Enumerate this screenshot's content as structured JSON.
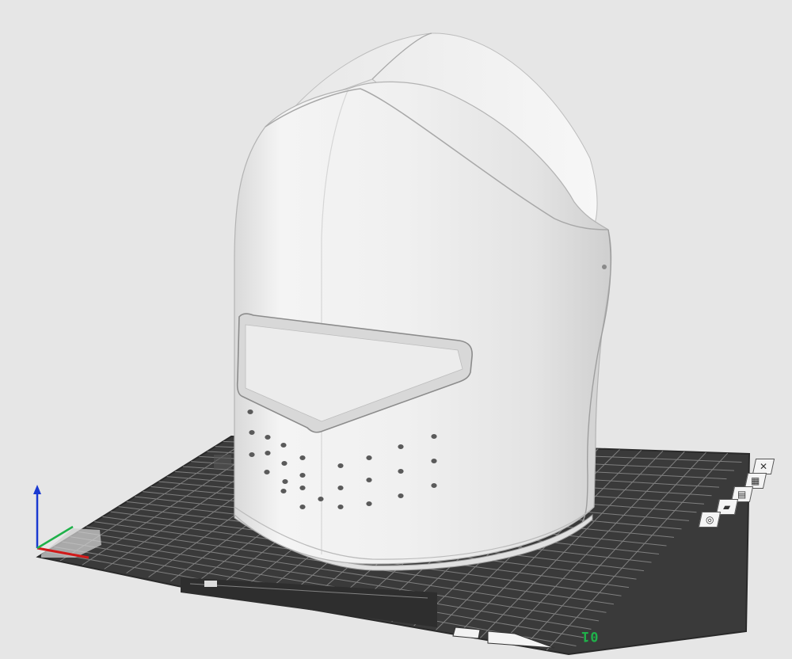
{
  "plate": {
    "id_label": "01"
  },
  "plate_tools": [
    {
      "name": "close-icon",
      "glyph": "✕"
    },
    {
      "name": "arrange-icon",
      "glyph": "▦"
    },
    {
      "name": "orient-icon",
      "glyph": "▤"
    },
    {
      "name": "lock-icon",
      "glyph": "▰"
    },
    {
      "name": "settings-icon",
      "glyph": "◎"
    }
  ],
  "colors": {
    "background": "#e6e6e6",
    "plate": "#3b3b3b",
    "grid": "#8a8a8a",
    "model": "#f0f0f0",
    "axis_x": "#d11a1a",
    "axis_y": "#1fb14a",
    "axis_z": "#1a3ad1"
  }
}
